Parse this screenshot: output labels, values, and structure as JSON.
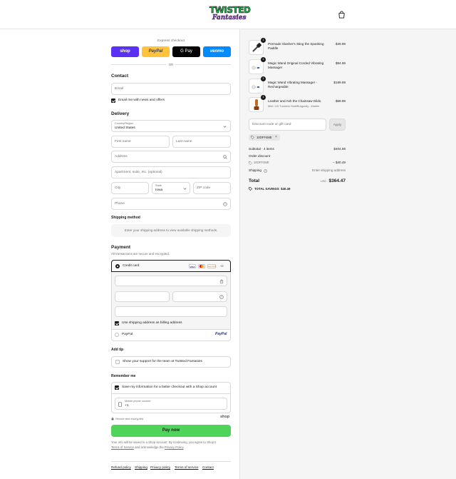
{
  "brand": {
    "logo_top": "TWISTED",
    "logo_bottom": "Fantasies"
  },
  "express": {
    "title": "Express checkout",
    "shop": "shop",
    "paypal": "PayPal",
    "gpay": "G Pay",
    "venmo": "venmo",
    "or": "OR"
  },
  "contact": {
    "heading": "Contact",
    "email_placeholder": "Email",
    "newsletter_label": "Email me with news and offers"
  },
  "delivery": {
    "heading": "Delivery",
    "country_label": "Country/Region",
    "country_value": "United States",
    "first_name": "First name",
    "last_name": "Last name",
    "address": "Address",
    "apartment": "Apartment, suite, etc. (optional)",
    "city": "City",
    "state_label": "State",
    "state_value": "Iowa",
    "zip": "ZIP code",
    "phone": "Phone"
  },
  "shipping": {
    "heading": "Shipping method",
    "note": "Enter your shipping address to view available shipping methods."
  },
  "payment": {
    "heading": "Payment",
    "subheading": "All transactions are secure and encrypted.",
    "credit_card_label": "Credit card",
    "card_brands": [
      "VISA",
      "MC",
      "DISCOVER"
    ],
    "more_brands": "+2",
    "billing_label": "Use shipping address as billing address",
    "paypal_label": "PayPal",
    "paypal_logo": "PayPal"
  },
  "tip": {
    "heading": "Add tip",
    "label": "Show your support for the team at Twisted Fantasies"
  },
  "remember": {
    "heading": "Remember me",
    "save_label": "Save my information for a faster checkout with a Shop account",
    "phone_label": "Mobile phone number",
    "phone_value": "+1",
    "secure_label": "Secure and encrypted",
    "shop_logo": "shop"
  },
  "pay_button": "Pay now",
  "legal": {
    "line1": "Your info will be saved to a Shop account. By continuing, you agree to Shop's",
    "terms": "Terms of Service",
    "and": " and acknowledge the ",
    "privacy": "Privacy Policy",
    "end": "."
  },
  "footer": {
    "refund": "Refund policy",
    "shipping": "Shipping",
    "privacy": "Privacy policy",
    "terms": "Terms of service",
    "contact": "Contact"
  },
  "order": {
    "items": [
      {
        "name": "Premade Slasher's Sting the Spanking Paddle",
        "variant": "",
        "price": "$49.99",
        "qty": "1"
      },
      {
        "name": "Magic Wand Original Corded Vibrating Massager",
        "variant": "",
        "price": "$94.99",
        "qty": "1"
      },
      {
        "name": "Magic Wand Vibrating Massager - Rechargeable",
        "variant": "",
        "price": "$189.99",
        "qty": "1"
      },
      {
        "name": "Leather and Ash the Chainsaw Dildo",
        "variant": "Mini / UV Turmeric Sold/Burgundy - Marble",
        "price": "$69.99",
        "qty": "1"
      }
    ],
    "discount_placeholder": "Discount code or gift card",
    "apply": "Apply",
    "code_chip": "10OFF4ME",
    "subtotal_label": "Subtotal · 4 items",
    "subtotal_value": "$404.96",
    "order_discount_label": "Order discount",
    "discount_code": "10OFF4ME",
    "discount_value": "– $40.49",
    "shipping_label": "Shipping",
    "shipping_value": "Enter shipping address",
    "total_label": "Total",
    "currency": "USD",
    "total_value": "$364.47",
    "savings_label": "TOTAL SAVINGS",
    "savings_value": "$40.49"
  }
}
